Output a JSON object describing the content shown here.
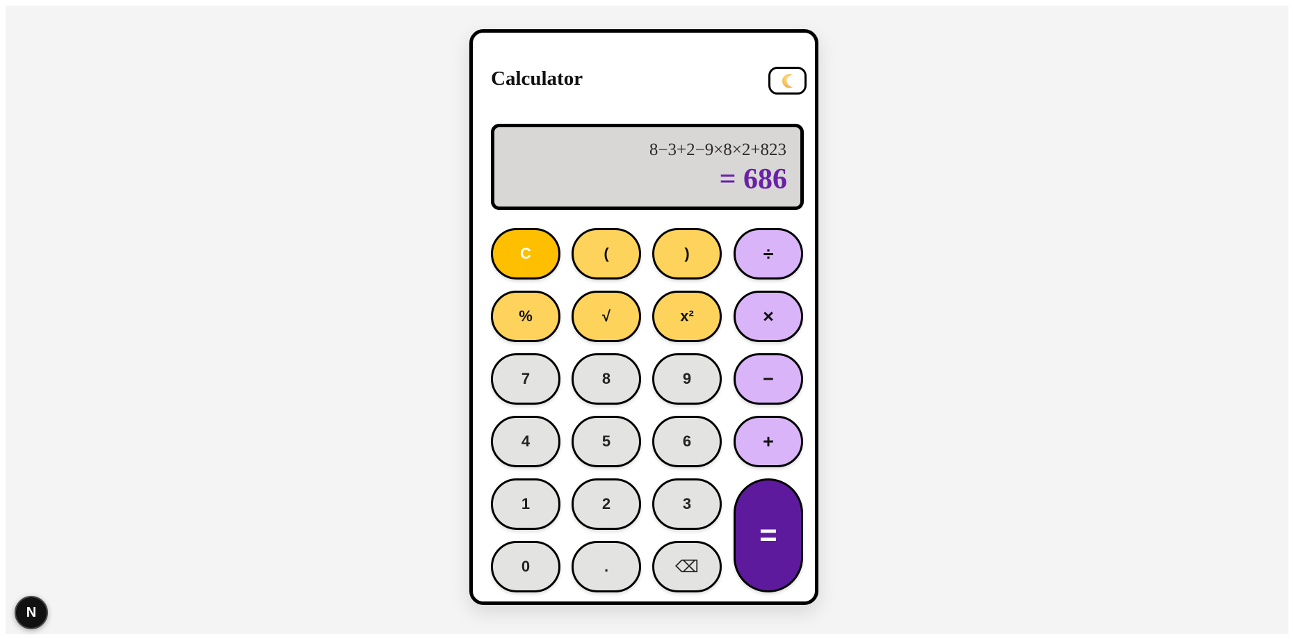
{
  "header": {
    "title": "Calculator",
    "theme_toggle_icon": "moon-icon"
  },
  "display": {
    "expression": "8−3+2−9×8×2+823",
    "result": "= 686"
  },
  "keypad": {
    "clear": "C",
    "open_paren": "(",
    "close_paren": ")",
    "divide": "÷",
    "percent": "%",
    "sqrt": "√",
    "square": "x²",
    "multiply": "×",
    "seven": "7",
    "eight": "8",
    "nine": "9",
    "minus": "−",
    "four": "4",
    "five": "5",
    "six": "6",
    "plus": "+",
    "one": "1",
    "two": "2",
    "three": "3",
    "equals": "=",
    "zero": "0",
    "decimal": ".",
    "backspace": "⌫"
  },
  "badge": {
    "label": "N"
  },
  "colors": {
    "function_key": "#fdd35c",
    "clear_key": "#fdbf00",
    "operator_key": "#d9b4f9",
    "equals_key": "#5e1a9d",
    "number_key": "#e3e3e1",
    "result_text": "#6a21a8",
    "display_bg": "#d8d7d5"
  }
}
